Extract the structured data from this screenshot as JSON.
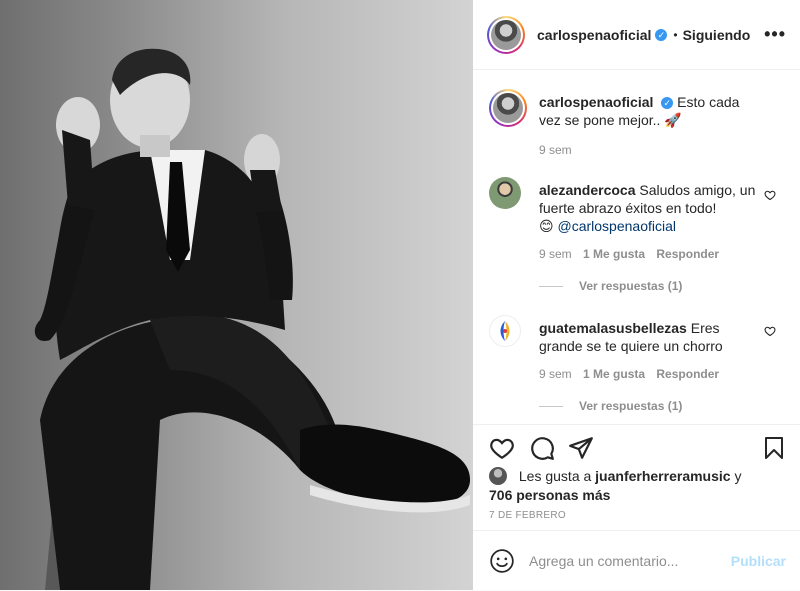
{
  "post": {
    "username": "carlospenaoficial",
    "verified": true,
    "follow_status": "Siguiendo",
    "separator": "•",
    "more_icon": "more-horizontal-icon"
  },
  "caption": {
    "username": "carlospenaoficial",
    "text": "Esto cada vez se pone mejor..",
    "emoji": "🚀",
    "time": "9 sem"
  },
  "comments": [
    {
      "username": "alezandercoca",
      "text": "Saludos amigo, un fuerte abrazo éxitos en todo!",
      "emoji": "😊",
      "mention": "@carlospenaoficial",
      "time": "9 sem",
      "likes": "1 Me gusta",
      "reply": "Responder",
      "view_replies": "Ver respuestas (1)"
    },
    {
      "username": "guatemalasusbellezas",
      "text": "Eres grande se te quiere un chorro",
      "time": "9 sem",
      "likes": "1 Me gusta",
      "reply": "Responder",
      "view_replies": "Ver respuestas (1)"
    }
  ],
  "likes_summary": {
    "prefix": "Les gusta a",
    "user": "juanferherreramusic",
    "joiner": "y",
    "others": "706 personas más"
  },
  "date": "7 DE FEBRERO",
  "add_comment": {
    "placeholder": "Agrega un comentario...",
    "publish": "Publicar"
  },
  "colors": {
    "verified": "#3897f0",
    "publish_disabled": "#b2dffc",
    "muted": "#8e8e8e",
    "text": "#262626"
  },
  "photo": {
    "description_icon": "photo-man-in-suit"
  }
}
